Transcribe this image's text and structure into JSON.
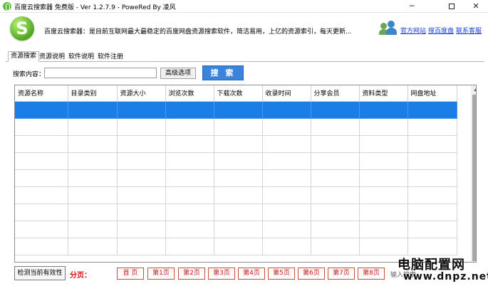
{
  "window": {
    "title": "百度云搜索器 免费版 - Ver 1.2.7.9 - PoweRed By 凌风",
    "minimize_glyph": "─",
    "close_glyph": "✕"
  },
  "header": {
    "logo_letter": "S",
    "marquee": "百度云搜索器：是目前互联网最大最稳定的百度网盘资源搜索软件，简洁易用，上亿的资源索引，每天更新...",
    "links": [
      "官方网站",
      "搜百度盘",
      "联系客服"
    ]
  },
  "tabs": [
    "资源搜索",
    "资源说明",
    "软件说明",
    "软件注册"
  ],
  "search": {
    "label": "搜索内容：",
    "value": "",
    "advanced_label": "高级选项",
    "search_label": "搜 索"
  },
  "table": {
    "columns": [
      "资源名称",
      "目录类别",
      "资源大小",
      "浏览次数",
      "下载次数",
      "收录时间",
      "分享会员",
      "资料类型",
      "网盘地址"
    ]
  },
  "bottom": {
    "check_label": "检测当前有效性",
    "page_label": "分页：",
    "pages": [
      "首 页",
      "第1页",
      "第2页",
      "第3页",
      "第4页",
      "第5页",
      "第6页",
      "第7页",
      "第8页"
    ],
    "hint": "输入搜索"
  },
  "watermark": {
    "cn": "电脑配置网",
    "en": "www.dnpz.net"
  }
}
